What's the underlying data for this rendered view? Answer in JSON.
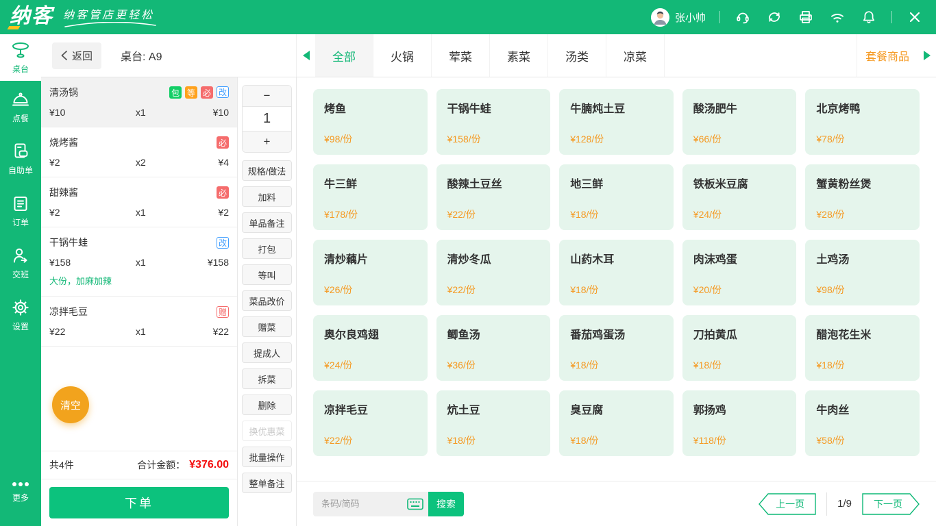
{
  "topbar": {
    "logo_text": "纳客",
    "slogan": "纳客管店更轻松",
    "username": "张小帅"
  },
  "sidebar": {
    "items": [
      {
        "label": "桌台",
        "active": true
      },
      {
        "label": "点餐"
      },
      {
        "label": "自助单"
      },
      {
        "label": "订单"
      },
      {
        "label": "交班"
      },
      {
        "label": "设置"
      }
    ],
    "more_label": "更多"
  },
  "header": {
    "back_label": "返回",
    "table_label": "桌台: A9",
    "tabs": [
      {
        "label": "全部",
        "active": true
      },
      {
        "label": "火锅"
      },
      {
        "label": "荤菜"
      },
      {
        "label": "素菜"
      },
      {
        "label": "汤类"
      },
      {
        "label": "凉菜"
      }
    ],
    "combo_label": "套餐商品"
  },
  "order": {
    "items": [
      {
        "name": "清汤锅",
        "price": "¥10",
        "qty": "x1",
        "total": "¥10",
        "selected": true,
        "badges": [
          {
            "text": "包",
            "type": "green"
          },
          {
            "text": "等",
            "type": "orange"
          },
          {
            "text": "必",
            "type": "red"
          },
          {
            "text": "改",
            "type": "blue-outline"
          }
        ]
      },
      {
        "name": "烧烤酱",
        "price": "¥2",
        "qty": "x2",
        "total": "¥4",
        "badges": [
          {
            "text": "必",
            "type": "red"
          }
        ]
      },
      {
        "name": "甜辣酱",
        "price": "¥2",
        "qty": "x1",
        "total": "¥2",
        "badges": [
          {
            "text": "必",
            "type": "red"
          }
        ]
      },
      {
        "name": "干锅牛蛙",
        "price": "¥158",
        "qty": "x1",
        "total": "¥158",
        "note": "大份，加麻加辣",
        "badges": [
          {
            "text": "改",
            "type": "blue-outline"
          }
        ]
      },
      {
        "name": "凉拌毛豆",
        "price": "¥22",
        "qty": "x1",
        "total": "¥22",
        "badges": [
          {
            "text": "赠",
            "type": "red-outline"
          }
        ]
      }
    ],
    "clear_label": "清空",
    "count_label": "共4件",
    "total_label": "合计金额：",
    "total_value": "¥376.00",
    "submit_label": "下单"
  },
  "actions": {
    "minus_label": "−",
    "qty_value": "1",
    "plus_label": "+",
    "buttons": [
      {
        "label": "规格/做法"
      },
      {
        "label": "加料"
      },
      {
        "label": "单品备注"
      },
      {
        "label": "打包"
      },
      {
        "label": "等叫"
      },
      {
        "label": "菜品改价"
      },
      {
        "label": "赠菜"
      },
      {
        "label": "提成人"
      },
      {
        "label": "拆菜"
      },
      {
        "label": "删除"
      },
      {
        "label": "换优惠菜",
        "disabled": true
      },
      {
        "label": "批量操作"
      },
      {
        "label": "整单备注"
      }
    ]
  },
  "menu": {
    "items": [
      {
        "name": "烤鱼",
        "price": "¥98/份"
      },
      {
        "name": "干锅牛蛙",
        "price": "¥158/份"
      },
      {
        "name": "牛腩炖土豆",
        "price": "¥128/份"
      },
      {
        "name": "酸汤肥牛",
        "price": "¥66/份"
      },
      {
        "name": "北京烤鸭",
        "price": "¥78/份"
      },
      {
        "name": "牛三鲜",
        "price": "¥178/份"
      },
      {
        "name": "酸辣土豆丝",
        "price": "¥22/份"
      },
      {
        "name": "地三鲜",
        "price": "¥18/份"
      },
      {
        "name": "铁板米豆腐",
        "price": "¥24/份"
      },
      {
        "name": "蟹黄粉丝煲",
        "price": "¥28/份"
      },
      {
        "name": "清炒藕片",
        "price": "¥26/份"
      },
      {
        "name": "清炒冬瓜",
        "price": "¥22/份"
      },
      {
        "name": "山药木耳",
        "price": "¥18/份"
      },
      {
        "name": "肉沫鸡蛋",
        "price": "¥20/份"
      },
      {
        "name": "土鸡汤",
        "price": "¥98/份"
      },
      {
        "name": "奥尔良鸡翅",
        "price": "¥24/份"
      },
      {
        "name": "鲫鱼汤",
        "price": "¥36/份"
      },
      {
        "name": "番茄鸡蛋汤",
        "price": "¥18/份"
      },
      {
        "name": "刀拍黄瓜",
        "price": "¥18/份"
      },
      {
        "name": "醋泡花生米",
        "price": "¥18/份"
      },
      {
        "name": "凉拌毛豆",
        "price": "¥22/份"
      },
      {
        "name": "炕土豆",
        "price": "¥18/份"
      },
      {
        "name": "臭豆腐",
        "price": "¥18/份"
      },
      {
        "name": "郭扬鸡",
        "price": "¥118/份"
      },
      {
        "name": "牛肉丝",
        "price": "¥58/份"
      }
    ]
  },
  "footer": {
    "search_placeholder": "条码/简码",
    "search_label": "搜索",
    "prev_label": "上一页",
    "page_indicator": "1/9",
    "next_label": "下一页"
  },
  "colors": {
    "brand_green": "#13b877",
    "button_green": "#0cc27d",
    "card_mint": "#e5f5ec",
    "price_orange": "#f59a23",
    "total_red": "#f30d0d",
    "clear_orange": "#f2a31d",
    "badge_green": "#13ce66",
    "badge_orange": "#ffa21d",
    "badge_red": "#f56c6c",
    "badge_blue": "#409eff"
  }
}
